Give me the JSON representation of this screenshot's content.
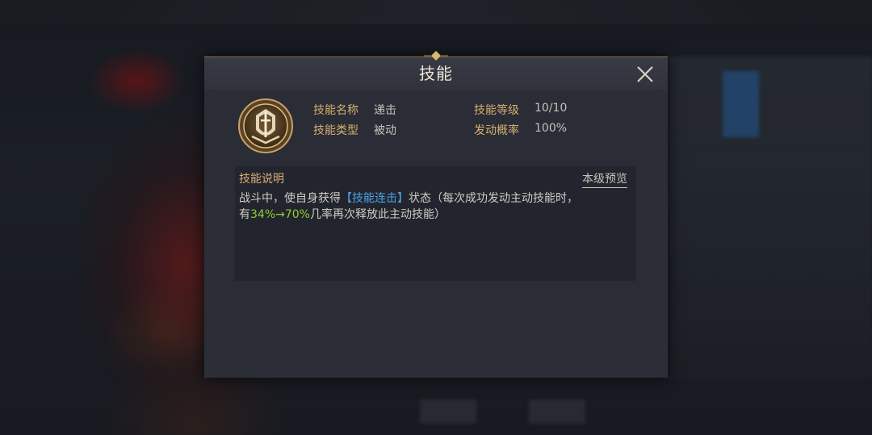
{
  "dialog": {
    "title": "技能",
    "close_icon": "close-icon"
  },
  "skill": {
    "icon": "skill-emblem-icon",
    "name_label": "技能名称",
    "name_value": "递击",
    "type_label": "技能类型",
    "type_value": "被动",
    "level_label": "技能等级",
    "level_value": "10/10",
    "rate_label": "发动概率",
    "rate_value": "100%"
  },
  "description": {
    "title": "技能说明",
    "preview_link": "本级预览",
    "line1_prefix": "战斗中，使自身获得",
    "line1_highlight": "【技能连击】",
    "line1_suffix": "状态（每次成功发动主动技能时，",
    "line2_prefix": "有",
    "line2_highlight": "34%→70%",
    "line2_suffix": "几率再次释放此主动技能）"
  },
  "colors": {
    "gold_label": "#d6b070",
    "highlight_blue": "#4aa3e8",
    "highlight_green": "#8fce2a",
    "panel": "#2b2d37"
  }
}
